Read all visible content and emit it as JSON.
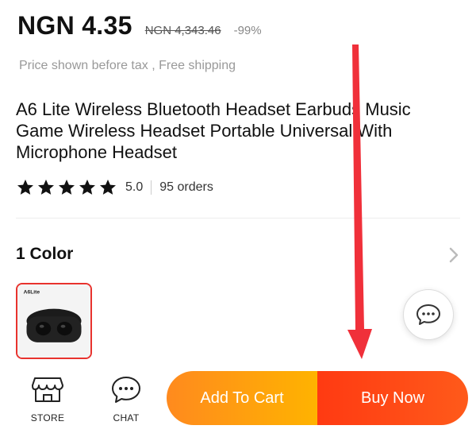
{
  "price": {
    "current": "NGN 4.35",
    "original": "NGN 4,343.46",
    "discount": "-99%",
    "note": "Price shown before tax , Free shipping"
  },
  "product": {
    "title": "A6 Lite Wireless Bluetooth Headset Earbuds Music Game Wireless Headset Portable Universal With Microphone Headset",
    "rating": "5.0",
    "rating_stars": 5,
    "orders": "95 orders"
  },
  "variants": {
    "heading": "1 Color",
    "thumb_label": "A6Lite"
  },
  "bottom_bar": {
    "store_label": "STORE",
    "chat_label": "CHAT",
    "add_to_cart": "Add To Cart",
    "buy_now": "Buy Now"
  },
  "icons": {
    "chevron": "chevron-right-icon",
    "chat_float": "chat-bubble-icon",
    "store": "store-icon",
    "chat": "chat-icon",
    "star": "star-icon"
  },
  "colors": {
    "accent_red": "#e8332e",
    "arrow": "#f0303a",
    "cart_from": "#ff8a1e",
    "cart_to": "#ffb300",
    "buy_from": "#ff3a12",
    "buy_to": "#ff5a1a"
  }
}
